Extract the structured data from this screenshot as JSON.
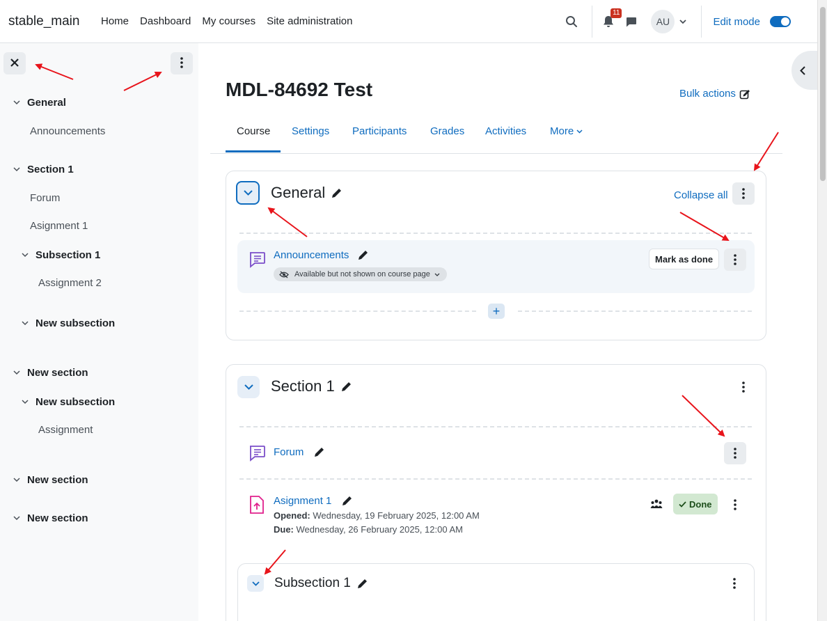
{
  "navbar": {
    "brand": "stable_main",
    "links": [
      "Home",
      "Dashboard",
      "My courses",
      "Site administration"
    ],
    "notification_count": "11",
    "avatar_initials": "AU",
    "edit_mode_label": "Edit mode",
    "edit_mode_on": true
  },
  "drawer": {
    "items": [
      {
        "type": "section",
        "label": "General"
      },
      {
        "type": "activity",
        "label": "Announcements"
      },
      {
        "type": "section",
        "label": "Section 1"
      },
      {
        "type": "activity",
        "label": "Forum"
      },
      {
        "type": "activity",
        "label": "Asignment 1"
      },
      {
        "type": "subsection",
        "label": "Subsection 1"
      },
      {
        "type": "activity",
        "label": "Assignment 2"
      },
      {
        "type": "subsection",
        "label": "New subsection"
      },
      {
        "type": "section",
        "label": "New section"
      },
      {
        "type": "subsection",
        "label": "New subsection"
      },
      {
        "type": "activity",
        "label": "Assignment"
      },
      {
        "type": "section",
        "label": "New section"
      },
      {
        "type": "section",
        "label": "New section"
      }
    ]
  },
  "course": {
    "title": "MDL-84692 Test",
    "bulk_actions": "Bulk actions",
    "tabs": [
      "Course",
      "Settings",
      "Participants",
      "Grades",
      "Activities",
      "More"
    ],
    "active_tab": "Course",
    "collapse_all": "Collapse all"
  },
  "sections": {
    "general": {
      "title": "General",
      "activity": {
        "name": "Announcements",
        "availability": "Available but not shown on course page",
        "button": "Mark as done"
      }
    },
    "section1": {
      "title": "Section 1",
      "forum": {
        "name": "Forum"
      },
      "assignment": {
        "name": "Asignment 1",
        "opened_label": "Opened:",
        "opened_value": "Wednesday, 19 February 2025, 12:00 AM",
        "due_label": "Due:",
        "due_value": "Wednesday, 26 February 2025, 12:00 AM",
        "done_label": "Done"
      },
      "subsection": {
        "title": "Subsection 1"
      }
    }
  },
  "colors": {
    "primary": "#0f6cbf",
    "annotation_arrow": "#e8141b",
    "forum_icon": "#7b4ec9",
    "assignment_icon": "#e0208c"
  }
}
